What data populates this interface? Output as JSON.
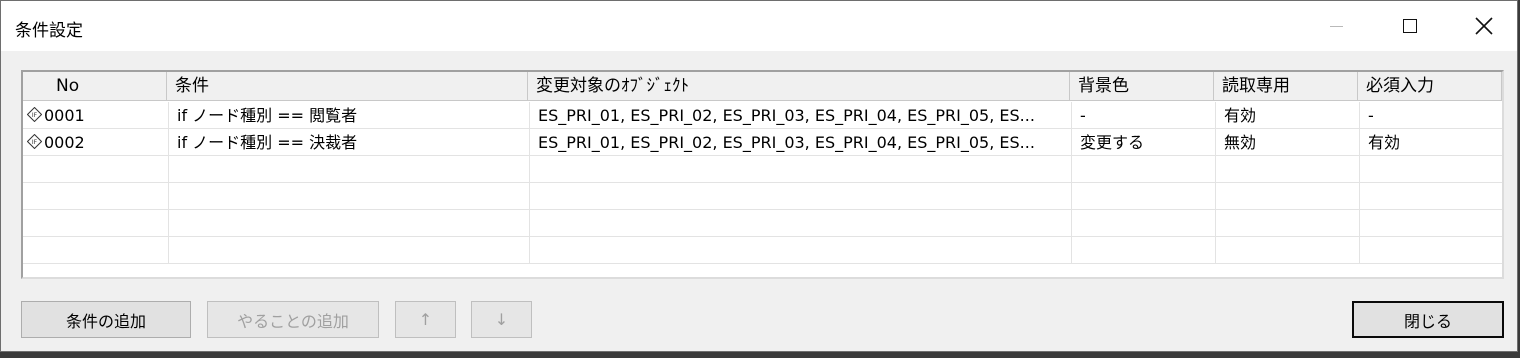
{
  "window": {
    "title": "条件設定"
  },
  "table": {
    "columns": [
      "No",
      "条件",
      "変更対象のｵﾌﾞｼﾞｪｸﾄ",
      "背景色",
      "読取専用",
      "必須入力"
    ],
    "rows": [
      {
        "no": "0001",
        "condition": "if ノード種別 == 閲覧者",
        "objects": "ES_PRI_01, ES_PRI_02, ES_PRI_03, ES_PRI_04, ES_PRI_05, ES...",
        "bgcolor": "-",
        "readonly": "有効",
        "required": "-"
      },
      {
        "no": "0002",
        "condition": "if ノード種別 == 決裁者",
        "objects": "ES_PRI_01, ES_PRI_02, ES_PRI_03, ES_PRI_04, ES_PRI_05, ES...",
        "bgcolor": "変更する",
        "readonly": "無効",
        "required": "有効"
      }
    ]
  },
  "buttons": {
    "add_condition": "条件の追加",
    "add_action": "やることの追加",
    "move_up": "↑",
    "move_down": "↓",
    "close": "閉じる"
  }
}
